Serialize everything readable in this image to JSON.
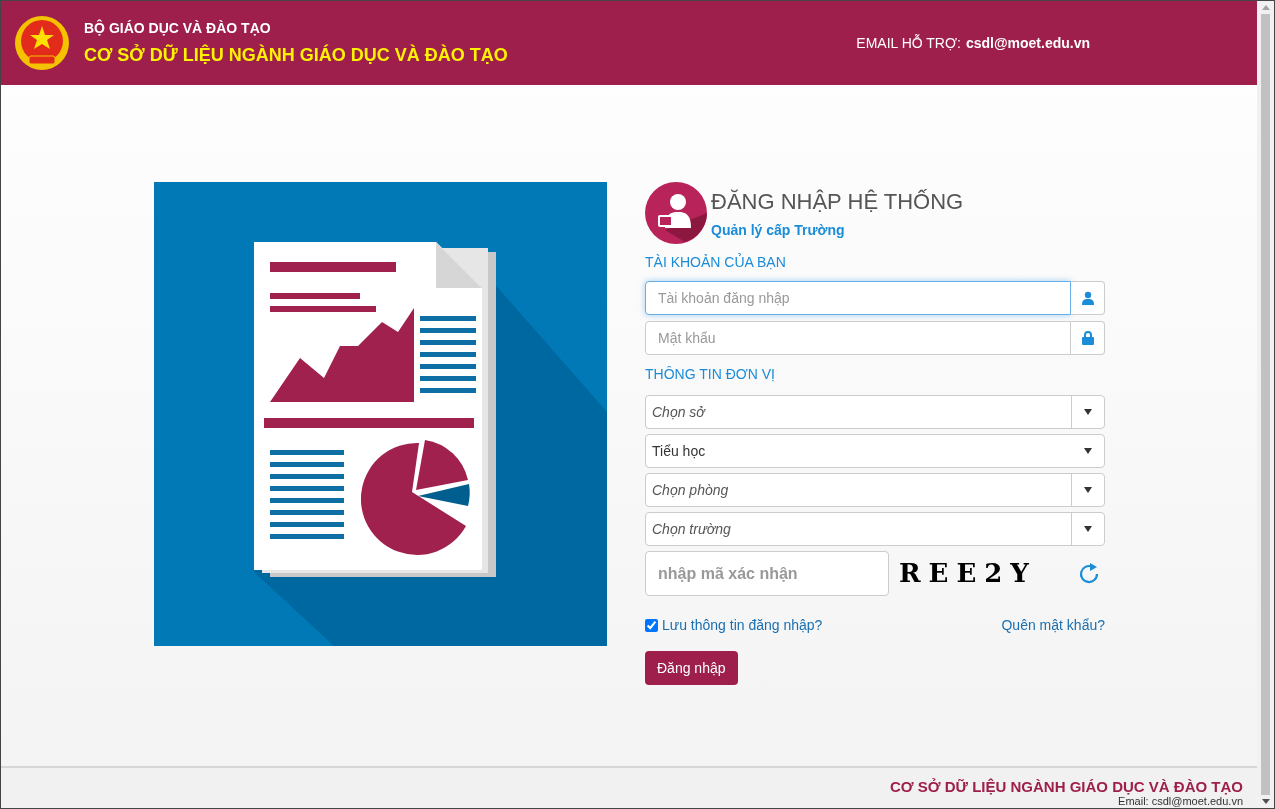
{
  "header": {
    "ministry": "BỘ GIÁO DỤC VÀ ĐÀO TẠO",
    "title": "CƠ SỞ DỮ LIỆU NGÀNH GIÁO DỤC VÀ ĐÀO TẠO",
    "support_label": "EMAIL HỖ TRỢ:",
    "support_email": "csdl@moet.edu.vn"
  },
  "login": {
    "title": "ĐĂNG NHẬP HỆ THỐNG",
    "subtitle": "Quản lý cấp Trường",
    "account_section": "TÀI KHOẢN CỦA BẠN",
    "fields": [
      {
        "kind": "user",
        "placeholder": "Tài khoản đăng nhập"
      },
      {
        "kind": "lock",
        "placeholder": "Mật khẩu"
      }
    ],
    "unit_section": "THÔNG TIN ĐƠN VỊ",
    "selects": [
      {
        "placeholder": "Chọn sở"
      },
      {
        "value": "Tiểu học"
      },
      {
        "placeholder": "Chọn phòng"
      },
      {
        "placeholder": "Chọn trường"
      }
    ],
    "captcha": {
      "placeholder": "nhập mã xác nhận",
      "code": "REE2Y"
    },
    "remember": {
      "label": "Lưu thông tin đăng nhập?",
      "checked": true
    },
    "forgot": "Quên mật khẩu?",
    "submit": "Đăng nhập"
  },
  "footer": {
    "title": "CƠ SỞ DỮ LIỆU NGÀNH GIÁO DỤC VÀ ĐÀO TẠO",
    "email": "Email: csdl@moet.edu.vn"
  }
}
